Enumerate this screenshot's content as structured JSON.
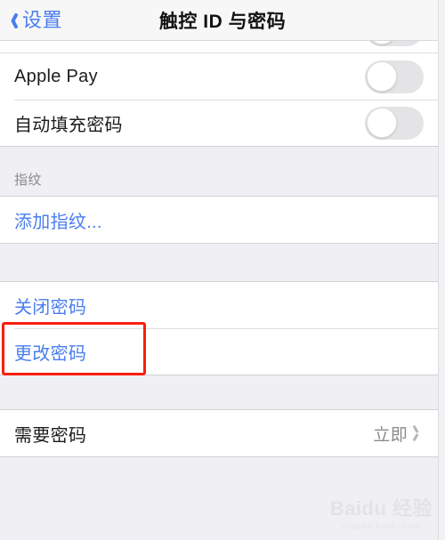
{
  "navbar": {
    "back_label": "设置",
    "title": "触控 ID 与密码",
    "back_icon": "chevron-left-icon",
    "accent_color": "#4a7ef0"
  },
  "sections": [
    {
      "id": "touchid-usage",
      "header": "",
      "rows": [
        {
          "id": "clipped-row",
          "label": "",
          "type": "toggle-clipped",
          "value": "off"
        },
        {
          "id": "apple-pay",
          "label": "Apple Pay",
          "type": "toggle",
          "value": "off"
        },
        {
          "id": "autofill-password",
          "label": "自动填充密码",
          "type": "toggle",
          "value": "off"
        }
      ]
    },
    {
      "id": "fingerprints",
      "header": "指纹",
      "rows": [
        {
          "id": "add-fingerprint",
          "label": "添加指纹...",
          "type": "link"
        }
      ]
    },
    {
      "id": "passcode-actions",
      "header": "",
      "rows": [
        {
          "id": "turn-off-passcode",
          "label": "关闭密码",
          "type": "link",
          "highlighted": true
        },
        {
          "id": "change-passcode",
          "label": "更改密码",
          "type": "link"
        }
      ]
    },
    {
      "id": "passcode-require",
      "header": "",
      "rows": [
        {
          "id": "require-passcode",
          "label": "需要密码",
          "type": "disclosure",
          "value": "立即"
        }
      ]
    }
  ],
  "annotation": {
    "target": "关闭密码",
    "color": "#f91d0c",
    "shape": "rectangle"
  },
  "watermark": {
    "main": "Baidu 经验",
    "sub": "jingyan.baidu.com"
  },
  "colors": {
    "background": "#efeff4",
    "row_background": "#ffffff",
    "link": "#4a7ef0",
    "label": "#1c1c1e",
    "secondary": "#8a8a8e",
    "separator": "#dedee2",
    "switch_off_track": "#e4e4e6"
  }
}
